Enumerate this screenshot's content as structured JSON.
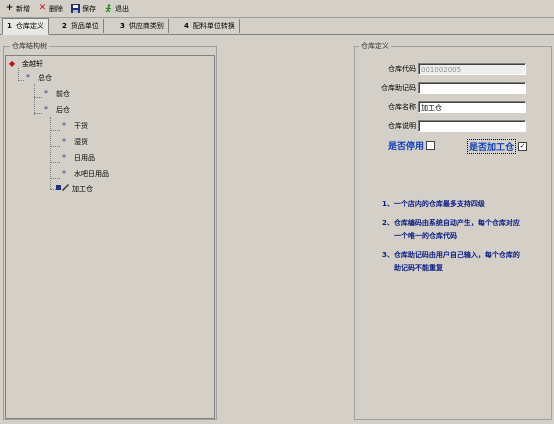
{
  "toolbar": {
    "add_label": "新增",
    "add_icon": "plus-icon",
    "delete_label": "删除",
    "delete_icon": "red-x-icon",
    "save_label": "保存",
    "save_icon": "floppy-disk-icon",
    "exit_label": "退出",
    "exit_icon": "exit-figure-icon"
  },
  "tabs": [
    {
      "num": "1",
      "label": "仓库定义"
    },
    {
      "num": "2",
      "label": "货品单位"
    },
    {
      "num": "3",
      "label": "供应商类别"
    },
    {
      "num": "4",
      "label": "配料单位转换"
    }
  ],
  "tree_panel": {
    "title": "仓库结构树",
    "root": "金越轩",
    "nodes": [
      "总仓",
      "前仓",
      "后仓",
      "干货",
      "湿货",
      "日用品",
      "水吧日用品",
      "加工仓"
    ]
  },
  "form_panel": {
    "title": "仓库定义",
    "code_label": "仓库代码",
    "code_value": "001002005",
    "mnemonic_label": "仓库助记码",
    "mnemonic_value": "",
    "name_label": "仓库名称",
    "name_value": "加工仓",
    "desc_label": "仓库说明",
    "desc_value": "",
    "disabled_label": "是否停用",
    "disabled_checked": false,
    "processing_label": "是否加工仓",
    "processing_checked": true
  },
  "notes": [
    "1、一个店内的仓库最多支持四级",
    "2、仓库编码由系统自动产生，每个仓库对应",
    "一个唯一的仓库代码",
    "3、仓库助记码由用户自己输入，每个仓库的",
    "助记码不能重复"
  ]
}
